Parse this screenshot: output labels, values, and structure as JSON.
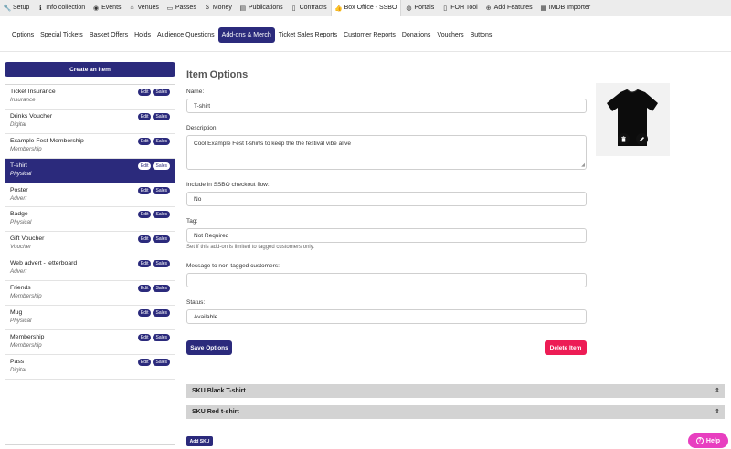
{
  "topnav": [
    {
      "label": "Setup",
      "icon": "wrench-icon",
      "glyph": "🔧"
    },
    {
      "label": "Info collection",
      "icon": "info-icon",
      "glyph": "ℹ"
    },
    {
      "label": "Events",
      "icon": "eye-icon",
      "glyph": "◉"
    },
    {
      "label": "Venues",
      "icon": "home-icon",
      "glyph": "⌂"
    },
    {
      "label": "Passes",
      "icon": "ticket-icon",
      "glyph": "▭"
    },
    {
      "label": "Money",
      "icon": "dollar-icon",
      "glyph": "$"
    },
    {
      "label": "Publications",
      "icon": "book-icon",
      "glyph": "▤"
    },
    {
      "label": "Contracts",
      "icon": "file-icon",
      "glyph": "▯"
    },
    {
      "label": "Box Office - SSBO",
      "icon": "thumbs-up-icon",
      "glyph": "👍",
      "active": true
    },
    {
      "label": "Portals",
      "icon": "globe-icon",
      "glyph": "◍"
    },
    {
      "label": "FOH Tool",
      "icon": "phone-icon",
      "glyph": "▯"
    },
    {
      "label": "Add Features",
      "icon": "plus-circle-icon",
      "glyph": "⊕"
    },
    {
      "label": "IMDB Importer",
      "icon": "film-icon",
      "glyph": "▦"
    }
  ],
  "subnav": [
    {
      "label": "Options"
    },
    {
      "label": "Special Tickets"
    },
    {
      "label": "Basket Offers"
    },
    {
      "label": "Holds"
    },
    {
      "label": "Audience Questions"
    },
    {
      "label": "Add-ons & Merch",
      "active": true
    },
    {
      "label": "Ticket Sales Reports"
    },
    {
      "label": "Customer Reports"
    },
    {
      "label": "Donations"
    },
    {
      "label": "Vouchers"
    },
    {
      "label": "Buttons"
    }
  ],
  "sidebar": {
    "create_label": "Create an Item",
    "edit_label": "Edit",
    "sales_label": "Sales",
    "items": [
      {
        "name": "Ticket Insurance",
        "type": "Insurance"
      },
      {
        "name": "Drinks Voucher",
        "type": "Digital"
      },
      {
        "name": "Example Fest Membership",
        "type": "Membership"
      },
      {
        "name": "T-shirt",
        "type": "Physical",
        "selected": true
      },
      {
        "name": "Poster",
        "type": "Advert"
      },
      {
        "name": "Badge",
        "type": "Physical"
      },
      {
        "name": "Gift Voucher",
        "type": "Voucher"
      },
      {
        "name": "Web advert - letterboard",
        "type": "Advert"
      },
      {
        "name": "Friends",
        "type": "Membership"
      },
      {
        "name": "Mug",
        "type": "Physical"
      },
      {
        "name": "Membership",
        "type": "Membership"
      },
      {
        "name": "Pass",
        "type": "Digital"
      }
    ]
  },
  "form": {
    "title": "Item Options",
    "name_label": "Name:",
    "name_value": "T-shirt",
    "description_label": "Description:",
    "description_value": "Cool Example Fest t-shirts to keep the the festival vibe alive",
    "checkout_label": "Include in SSBO checkout flow:",
    "checkout_value": "No",
    "tag_label": "Tag:",
    "tag_value": "Not Required",
    "tag_help": "Set if this add-on is limited to tagged customers only.",
    "message_label": "Message to non-tagged customers:",
    "message_value": "",
    "status_label": "Status:",
    "status_value": "Available",
    "save_label": "Save Options",
    "delete_label": "Delete Item"
  },
  "skus": [
    {
      "label": "SKU Black T-shirt"
    },
    {
      "label": "SKU Red t-shirt"
    }
  ],
  "add_sku_label": "Add SKU",
  "help_label": "Help",
  "colors": {
    "primary": "#2b2a7c",
    "danger": "#ed1c55",
    "help": "#e83fc0"
  }
}
